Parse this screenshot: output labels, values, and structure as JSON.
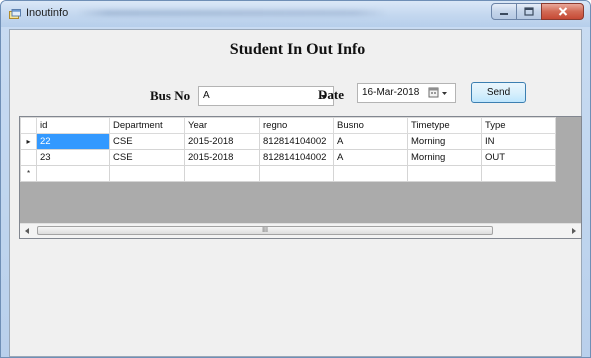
{
  "window": {
    "title": "Inoutinfo"
  },
  "form": {
    "heading": "Student In Out Info",
    "bus_no_label": "Bus No",
    "bus_no_value": "A",
    "date_label": "Date",
    "date_value": "16-Mar-2018",
    "send_label": "Send"
  },
  "grid": {
    "columns": [
      "id",
      "Department",
      "Year",
      "regno",
      "Busno",
      "Timetype",
      "Type"
    ],
    "rows": [
      {
        "id": "22",
        "department": "CSE",
        "year": "2015-2018",
        "regno": "812814104002",
        "busno": "A",
        "timetype": "Morning",
        "type": "IN"
      },
      {
        "id": "23",
        "department": "CSE",
        "year": "2015-2018",
        "regno": "812814104002",
        "busno": "A",
        "timetype": "Morning",
        "type": "OUT"
      }
    ],
    "current_row_marker": "▸",
    "new_row_marker": "*",
    "scroll_thumb_grip": "III"
  },
  "colors": {
    "selection": "#3399ff",
    "grid_background": "#ababab",
    "form_background": "#f0f0f0"
  },
  "icons": [
    "app-icon",
    "minimize-icon",
    "maximize-icon",
    "close-icon",
    "calendar-dropdown-icon",
    "combo-dropdown-icon"
  ]
}
